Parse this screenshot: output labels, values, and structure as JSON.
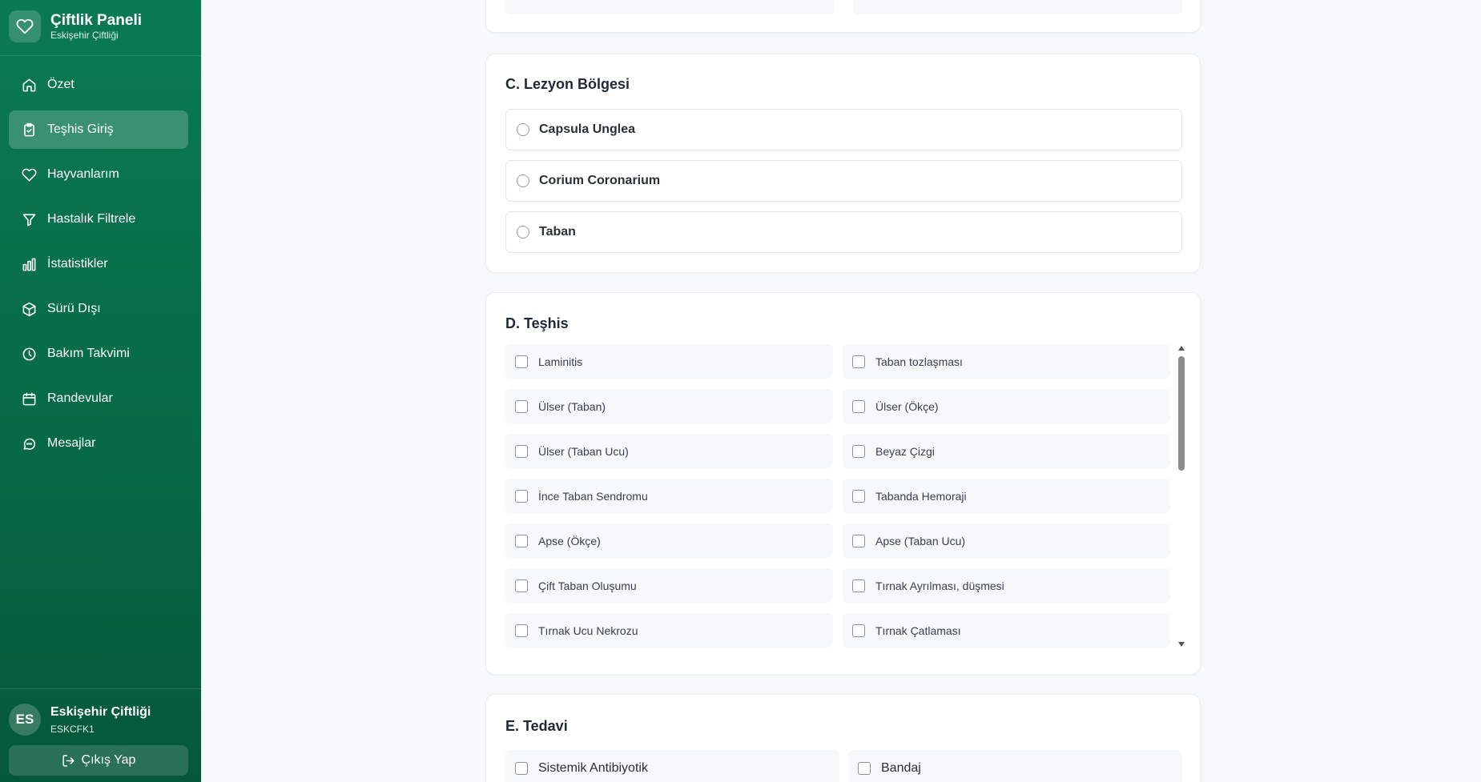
{
  "brand": {
    "title": "Çiftlik Paneli",
    "subtitle": "Eskişehir Çiftliği",
    "icon": "heart-icon"
  },
  "nav": [
    {
      "label": "Özet",
      "icon": "home-icon",
      "active": false
    },
    {
      "label": "Teşhis Giriş",
      "icon": "clipboard-check-icon",
      "active": true
    },
    {
      "label": "Hayvanlarım",
      "icon": "heart-icon",
      "active": false
    },
    {
      "label": "Hastalık Filtrele",
      "icon": "filter-icon",
      "active": false
    },
    {
      "label": "İstatistikler",
      "icon": "bar-chart-icon",
      "active": false
    },
    {
      "label": "Sürü Dışı",
      "icon": "box-icon",
      "active": false
    },
    {
      "label": "Bakım Takvimi",
      "icon": "clock-icon",
      "active": false
    },
    {
      "label": "Randevular",
      "icon": "calendar-icon",
      "active": false
    },
    {
      "label": "Mesajlar",
      "icon": "message-icon",
      "active": false
    }
  ],
  "user": {
    "initials": "ES",
    "name": "Eskişehir Çiftliği",
    "code": "ESKCFK1"
  },
  "logout": {
    "label": "Çıkış Yap",
    "icon": "logout-icon"
  },
  "lesion": {
    "title": "C. Lezyon Bölgesi",
    "options": [
      "Capsula Unglea",
      "Corium Coronarium",
      "Taban"
    ]
  },
  "diagnosis": {
    "title": "D. Teşhis",
    "items": [
      "Laminitis",
      "Taban tozlaşması",
      "Ülser (Taban)",
      "Ülser (Ökçe)",
      "Ülser (Taban Ucu)",
      "Beyaz Çizgi",
      "İnce Taban Sendromu",
      "Tabanda Hemoraji",
      "Apse (Ökçe)",
      "Apse (Taban Ucu)",
      "Çift Taban Oluşumu",
      "Tırnak Ayrılması, düşmesi",
      "Tırnak Ucu Nekrozu",
      "Tırnak Çatlaması"
    ]
  },
  "treatment": {
    "title": "E. Tedavi",
    "items": [
      "Sistemik Antibiyotik",
      "Bandaj"
    ]
  },
  "colors": {
    "sidebar": "#0a7a52",
    "background": "#f7f8f9"
  }
}
